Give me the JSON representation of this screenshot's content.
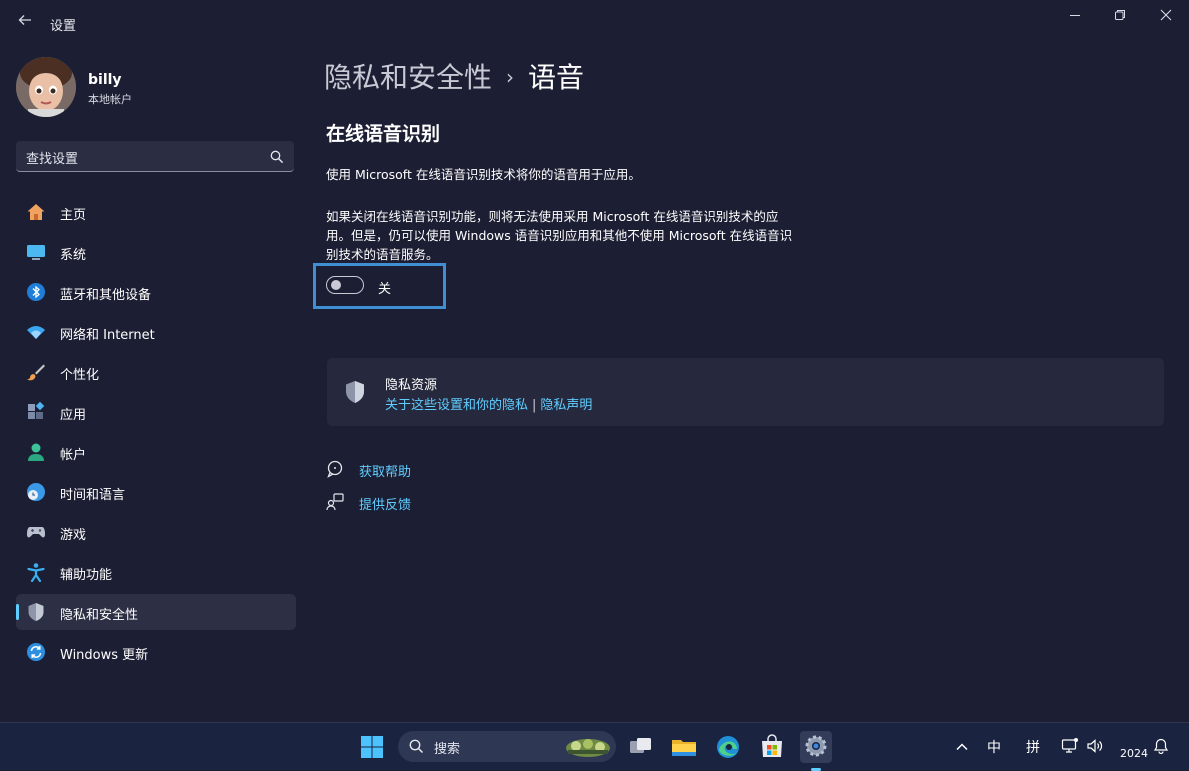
{
  "window": {
    "title": "设置"
  },
  "profile": {
    "name": "billy",
    "account_type": "本地帐户"
  },
  "search": {
    "placeholder": "查找设置"
  },
  "nav": {
    "items": [
      {
        "label": "主页"
      },
      {
        "label": "系统"
      },
      {
        "label": "蓝牙和其他设备"
      },
      {
        "label": "网络和 Internet"
      },
      {
        "label": "个性化"
      },
      {
        "label": "应用"
      },
      {
        "label": "帐户"
      },
      {
        "label": "时间和语言"
      },
      {
        "label": "游戏"
      },
      {
        "label": "辅助功能"
      },
      {
        "label": "隐私和安全性",
        "active": true
      },
      {
        "label": "Windows 更新"
      }
    ]
  },
  "breadcrumb": {
    "parent": "隐私和安全性",
    "separator": "›",
    "current": "语音"
  },
  "section": {
    "title": "在线语音识别",
    "description1": "使用 Microsoft 在线语音识别技术将你的语音用于应用。",
    "description2": "如果关闭在线语音识别功能，则将无法使用采用 Microsoft 在线语音识别技术的应用。但是，仍可以使用 Windows 语音识别应用和其他不使用 Microsoft 在线语音识别技术的语音服务。",
    "toggle_state": "关"
  },
  "privacy_resources": {
    "title": "隐私资源",
    "link1": "关于这些设置和你的隐私",
    "separator": "|",
    "link2": "隐私声明"
  },
  "help": {
    "get_help": "获取帮助",
    "feedback": "提供反馈"
  },
  "taskbar": {
    "search_label": "搜索",
    "ime_mode": "中",
    "ime_input": "拼",
    "year": "2024"
  },
  "colors": {
    "background": "#1c1f33",
    "accent": "#60cdff",
    "focus": "#3f8fd2",
    "card": "#26293d"
  }
}
